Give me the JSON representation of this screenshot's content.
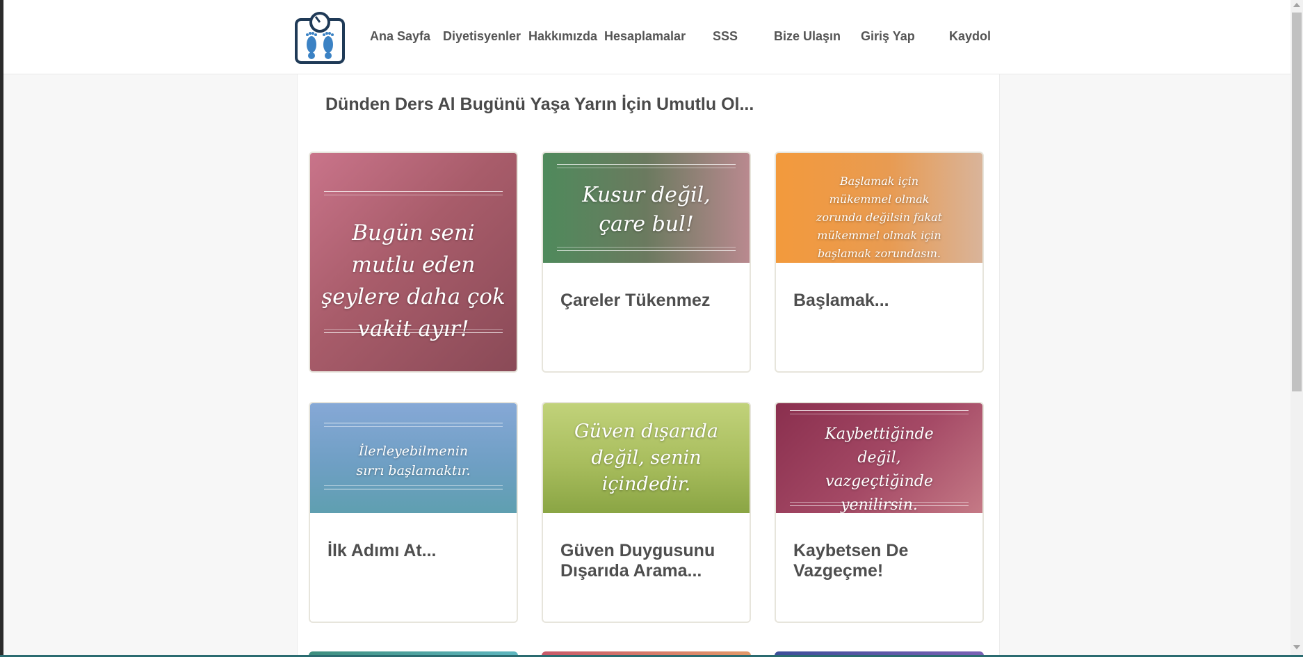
{
  "nav": {
    "items": [
      {
        "label": "Ana Sayfa"
      },
      {
        "label": "Diyetisyenler"
      },
      {
        "label": "Hakkımızda"
      },
      {
        "label": "Hesaplamalar"
      },
      {
        "label": "SSS"
      },
      {
        "label": "Bize Ulaşın"
      },
      {
        "label": "Giriş Yap"
      },
      {
        "label": "Kaydol"
      }
    ]
  },
  "page": {
    "title": "Dünden Ders Al Bugünü Yaşa Yarın İçin Umutlu Ol..."
  },
  "cards": [
    {
      "title": "",
      "image_text": "Bugün seni mutlu eden şeylere daha çok vakit ayır!",
      "color": "#b35a6a"
    },
    {
      "title": "Çareler Tükenmez",
      "image_text": "Kusur değil, çare bul!",
      "color": "#5d8a64"
    },
    {
      "title": "Başlamak...",
      "image_text": "Başlamak için mükemmel olmak zorunda değilsin fakat mükemmel olmak için başlamak zorundasın.",
      "color": "#e39a4a"
    },
    {
      "title": "İlk Adımı At...",
      "image_text": "İlerleyebilmenin sırrı başlamaktır.",
      "color": "#6e9fc9"
    },
    {
      "title": "Güven Duygusunu Dışarıda Arama...",
      "image_text": "Güven dışarıda değil, senin içindedir.",
      "color": "#a6bf5a"
    },
    {
      "title": "Kaybetsen De Vazgeçme!",
      "image_text": "Kaybettiğinde değil, vazgeçtiğinde yenilirsin.",
      "color": "#963e5b"
    }
  ],
  "icons": {
    "logo": "scale-footprints-icon"
  }
}
